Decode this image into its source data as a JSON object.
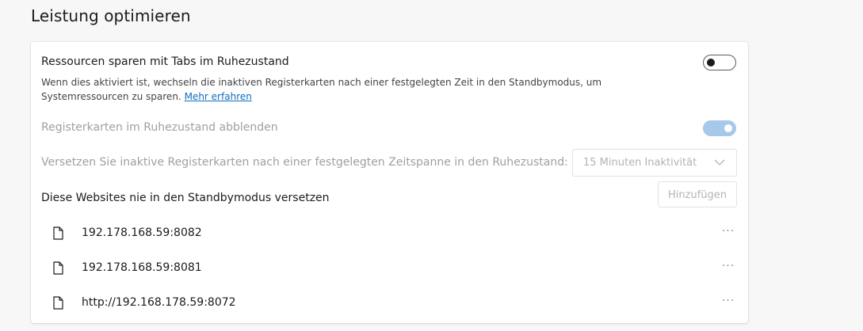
{
  "page": {
    "title": "Leistung optimieren"
  },
  "sleeping_tabs": {
    "title": "Ressourcen sparen mit Tabs im Ruhezustand",
    "description": "Wenn dies aktiviert ist, wechseln die inaktiven Registerkarten nach einer festgelegten Zeit in den Standbymodus, um Systemressourcen zu sparen.",
    "learn_more": "Mehr erfahren",
    "enabled": false
  },
  "fade_tabs": {
    "label": "Registerkarten im Ruhezustand abblenden",
    "enabled": true,
    "disabled": true
  },
  "timeout": {
    "label": "Versetzen Sie inaktive Registerkarten nach einer festgelegten Zeitspanne in den Ruhezustand:",
    "selected": "15 Minuten Inaktivität"
  },
  "exclusions": {
    "title": "Diese Websites nie in den Standbymodus versetzen",
    "add_label": "Hinzufügen",
    "more_label": "···",
    "sites": [
      "192.178.168.59:8082",
      "192.178.168.59:8081",
      "http://192.168.178.59:8072"
    ]
  },
  "colors": {
    "link": "#0f6cbd",
    "toggle_on_disabled": "#a8c8ea",
    "disabled_text": "#a0a0a0"
  }
}
